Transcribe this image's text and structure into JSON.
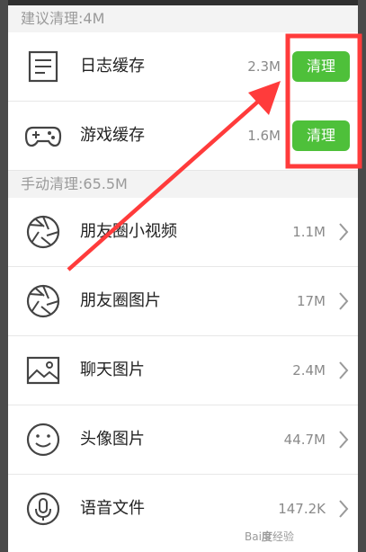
{
  "sections": [
    {
      "header": "建议清理:4M",
      "rows": [
        {
          "label": "日志缓存",
          "size": "2.3M",
          "icon": "document-icon",
          "action": "清理"
        },
        {
          "label": "游戏缓存",
          "size": "1.6M",
          "icon": "gamepad-icon",
          "action": "清理"
        }
      ]
    },
    {
      "header": "手动清理:65.5M",
      "rows": [
        {
          "label": "朋友圈小视频",
          "size": "1.1M",
          "icon": "aperture-icon"
        },
        {
          "label": "朋友圈图片",
          "size": "17M",
          "icon": "aperture-icon"
        },
        {
          "label": "聊天图片",
          "size": "2.4M",
          "icon": "image-icon"
        },
        {
          "label": "头像图片",
          "size": "44.7M",
          "icon": "smiley-icon"
        },
        {
          "label": "语音文件",
          "size": "147.2K",
          "icon": "microphone-icon"
        }
      ]
    }
  ],
  "colors": {
    "button": "#4ec03a",
    "annotation": "#ff3b3b"
  }
}
